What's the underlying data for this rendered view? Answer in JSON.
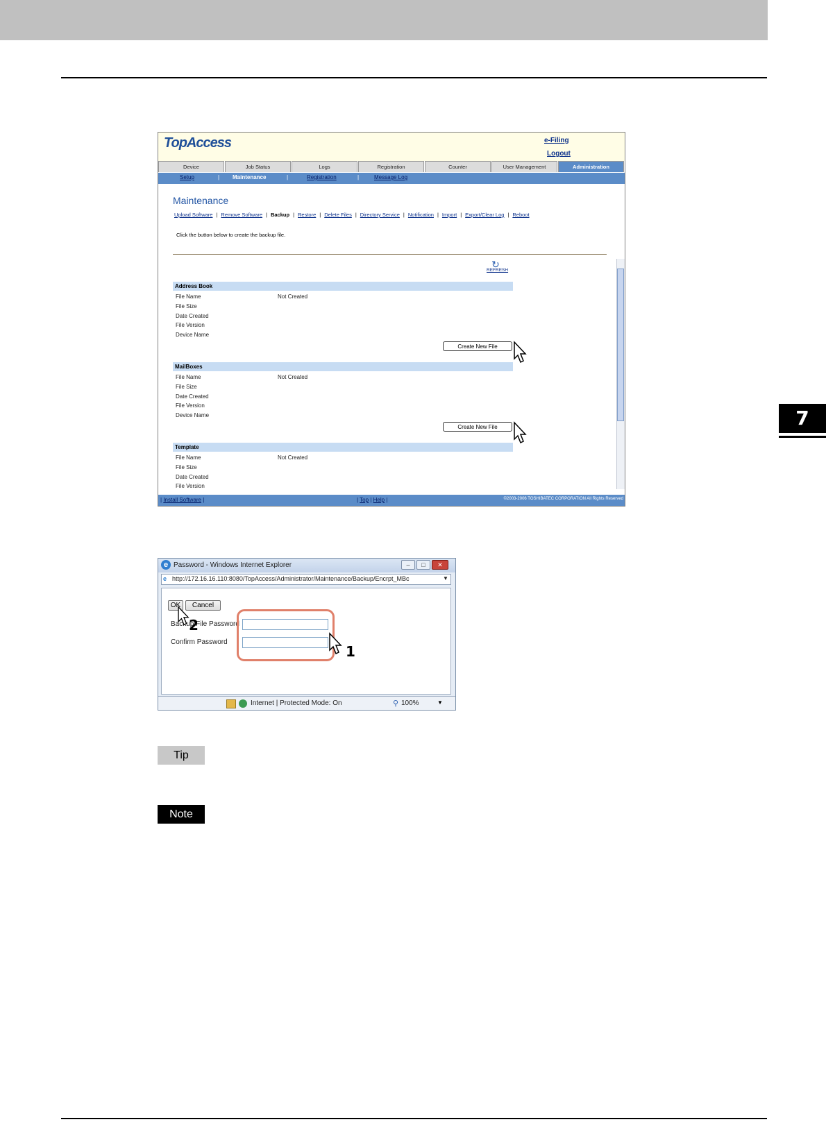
{
  "chapter_number": "7",
  "topaccess": {
    "logo": "TopAccess",
    "header_links": {
      "efiling": "e-Filing",
      "logout": "Logout"
    },
    "tabs": [
      "Device",
      "Job Status",
      "Logs",
      "Registration",
      "Counter",
      "User Management",
      "Administration"
    ],
    "active_tab": "Administration",
    "subnav": [
      "Setup",
      "Maintenance",
      "Registration",
      "Message Log"
    ],
    "active_subnav": "Maintenance",
    "page_title": "Maintenance",
    "maintenance_links": [
      "Upload Software",
      "Remove Software",
      "Backup",
      "Restore",
      "Delete Files",
      "Directory Service",
      "Notification",
      "Import",
      "Export/Clear Log",
      "Reboot"
    ],
    "current_link": "Backup",
    "instruction": "Click the button below to create the backup file.",
    "refresh_label": "REFRESH",
    "sections": [
      {
        "title": "Address Book",
        "fields": [
          "File Name",
          "File Size",
          "Date Created",
          "File Version",
          "Device Name"
        ],
        "file_name_value": "Not Created",
        "button": "Create New File"
      },
      {
        "title": "MailBoxes",
        "fields": [
          "File Name",
          "File Size",
          "Date Created",
          "File Version",
          "Device Name"
        ],
        "file_name_value": "Not Created",
        "button": "Create New File"
      },
      {
        "title": "Template",
        "fields": [
          "File Name",
          "File Size",
          "Date Created",
          "File Version"
        ],
        "file_name_value": "Not Created"
      }
    ],
    "footer": {
      "install": "Install Software",
      "top": "Top",
      "help": "Help",
      "copyright": "©2003-2006 TOSHIBATEC CORPORATION All Rights Reserved"
    }
  },
  "password_dialog": {
    "window_title": "Password - Windows Internet Explorer",
    "url": "http://172.16.16.110:8080/TopAccess/Administrator/Maintenance/Backup/Encrpt_MBc",
    "ok_label": "OK",
    "cancel_label": "Cancel",
    "backup_password_label": "Backup File Password",
    "confirm_password_label": "Confirm Password",
    "status_text": "Internet | Protected Mode: On",
    "zoom": "100%",
    "callouts": [
      "1",
      "2"
    ]
  },
  "tip_label": "Tip",
  "note_label": "Note"
}
